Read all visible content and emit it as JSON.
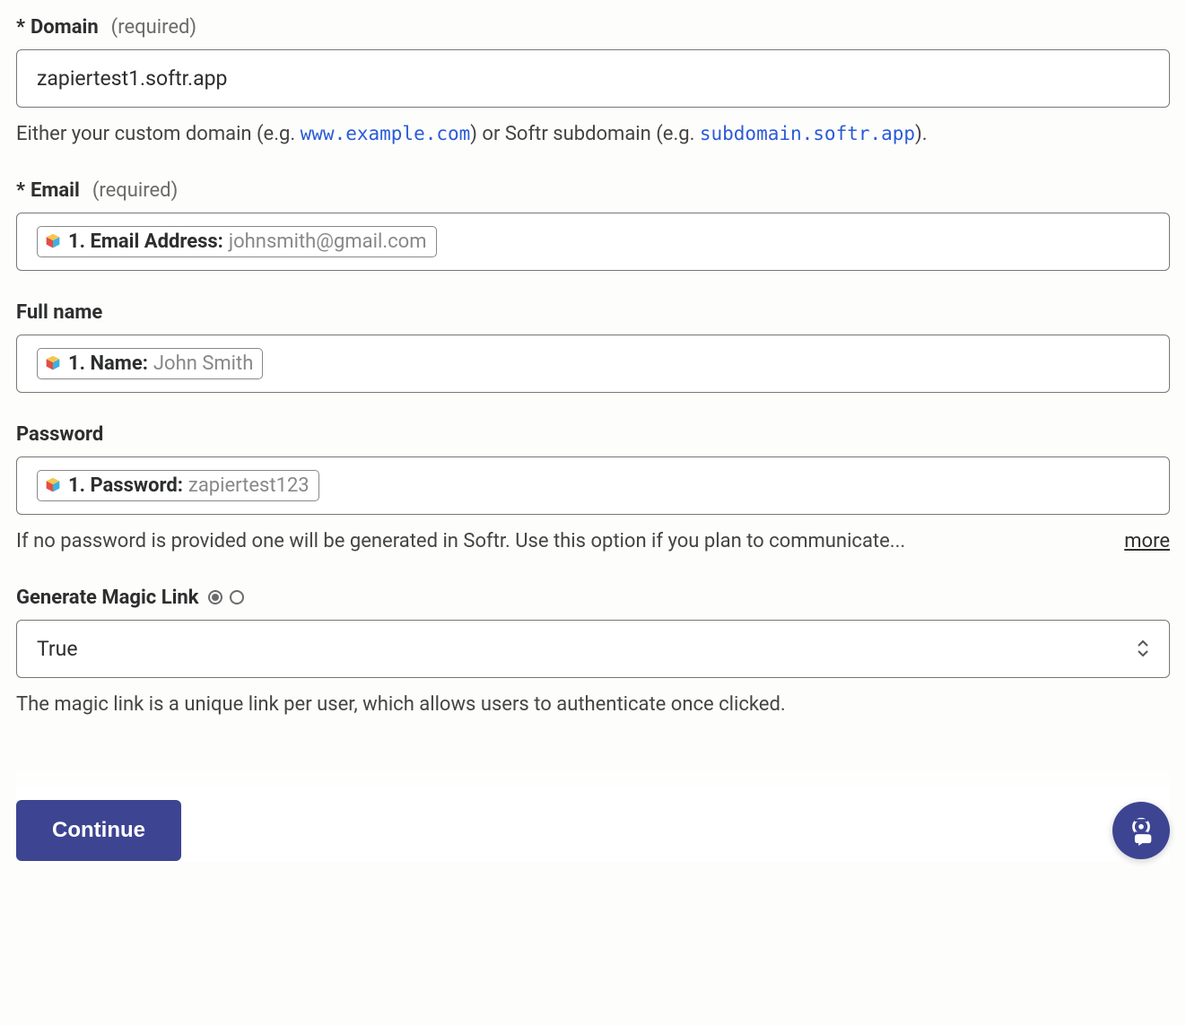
{
  "domain": {
    "label": "Domain",
    "required_text": "(required)",
    "value": "zapiertest1.softr.app",
    "helper_pre": "Either your custom domain (e.g. ",
    "helper_code1": "www.example.com",
    "helper_mid": ") or Softr subdomain (e.g. ",
    "helper_code2": "subdomain.softr.app",
    "helper_post": ")."
  },
  "email": {
    "label": "Email",
    "required_text": "(required)",
    "pill_label": "1. Email Address:",
    "pill_value": "johnsmith@gmail.com"
  },
  "fullname": {
    "label": "Full name",
    "pill_label": "1. Name:",
    "pill_value": "John Smith"
  },
  "password": {
    "label": "Password",
    "pill_label": "1. Password:",
    "pill_value": "zapiertest123",
    "helper": "If no password is provided one will be generated in Softr. Use this option if you plan to communicate...",
    "more": "more"
  },
  "magic": {
    "label": "Generate Magic Link",
    "value": "True",
    "helper": "The magic link is a unique link per user, which allows users to authenticate once clicked."
  },
  "footer": {
    "continue": "Continue"
  }
}
